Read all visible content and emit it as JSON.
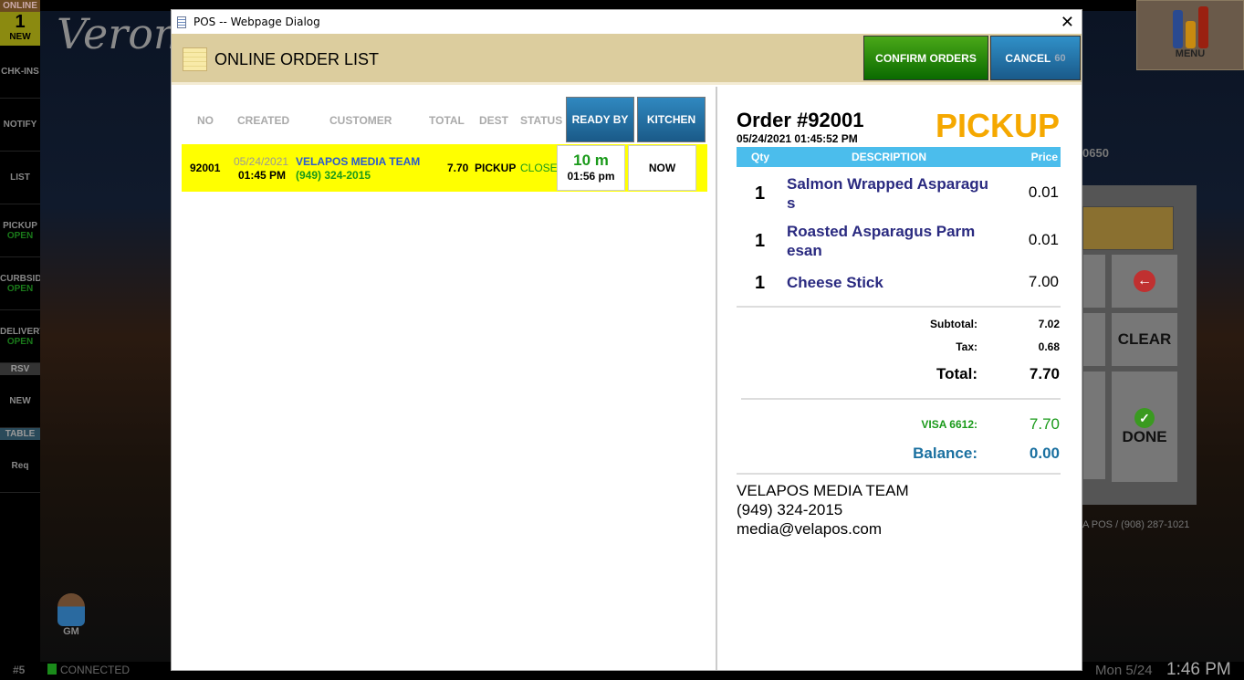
{
  "background": {
    "title": "Verona",
    "phone_fragment": "0650",
    "footer_fragment": "A POS / (908) 287-1021",
    "keypad": {
      "clear": "CLEAR",
      "done": "DONE"
    }
  },
  "sidebar": {
    "header": "ONLINE",
    "new_count": "1",
    "new_label": "NEW",
    "items": [
      {
        "label": "CHK-INS"
      },
      {
        "label": "NOTIFY"
      },
      {
        "label": "LIST"
      },
      {
        "label": "PICKUP",
        "status": "OPEN"
      },
      {
        "label": "CURBSIDE",
        "status": "OPEN"
      },
      {
        "label": "DELIVERY",
        "status": "OPEN"
      }
    ],
    "rsv_header": "RSV",
    "rsv_item": "NEW",
    "table_header": "TABLE",
    "table_item": "Req",
    "user": "GM"
  },
  "menu": {
    "label": "MENU"
  },
  "statusbar": {
    "station": "#5",
    "connection": "CONNECTED",
    "date": "Mon 5/24",
    "time": "1:46 PM"
  },
  "dialog": {
    "title": "POS -- Webpage Dialog",
    "header": "ONLINE ORDER LIST",
    "confirm_label": "CONFIRM ORDERS",
    "cancel_label": "CANCEL",
    "cancel_countdown": "60",
    "columns": [
      "NO",
      "CREATED",
      "CUSTOMER",
      "TOTAL",
      "DEST",
      "STATUS",
      "READY BY",
      "KITCHEN"
    ],
    "orders": [
      {
        "no": "92001",
        "date": "05/24/2021",
        "time": "01:45 PM",
        "customer": "VELAPOS MEDIA TEAM",
        "phone": "(949) 324-2015",
        "total": "7.70",
        "dest": "PICKUP",
        "status": "CLOSED",
        "ready_in": "10 m",
        "ready_at": "01:56 pm",
        "kitchen": "NOW"
      }
    ],
    "detail": {
      "order_no": "Order #92001",
      "datetime": "05/24/2021 01:45:52 PM",
      "dest": "PICKUP",
      "item_headers": {
        "qty": "Qty",
        "description": "DESCRIPTION",
        "price": "Price"
      },
      "items": [
        {
          "qty": "1",
          "description": "Salmon Wrapped Asparagus",
          "price": "0.01"
        },
        {
          "qty": "1",
          "description": "Roasted Asparagus Parmesan",
          "price": "0.01"
        },
        {
          "qty": "1",
          "description": "Cheese Stick",
          "price": "7.00"
        }
      ],
      "subtotal_label": "Subtotal:",
      "subtotal": "7.02",
      "tax_label": "Tax:",
      "tax": "0.68",
      "total_label": "Total:",
      "total": "7.70",
      "payment_label": "VISA 6612:",
      "payment": "7.70",
      "balance_label": "Balance:",
      "balance": "0.00",
      "customer_name": "VELAPOS MEDIA TEAM",
      "customer_phone": "(949) 324-2015",
      "customer_email": "media@velapos.com"
    }
  },
  "colors": {
    "highlight_row": "#ffff00",
    "pickup": "#f5a800",
    "confirm": "#2a8a0a",
    "cancel": "#2a78b0",
    "item_header": "#4bbdec",
    "balance": "#1a70a0",
    "paid": "#1a9a1a"
  }
}
